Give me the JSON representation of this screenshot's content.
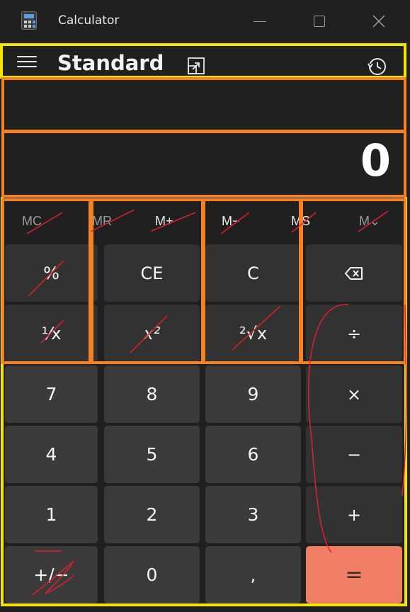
{
  "window": {
    "title": "Calculator"
  },
  "header": {
    "mode": "Standard"
  },
  "display": {
    "expression": "",
    "value": "0"
  },
  "memory": {
    "mc": "MC",
    "mr": "MR",
    "m_plus": "M+",
    "m_minus": "M−",
    "ms": "MS",
    "m_list": "M⌄"
  },
  "keypad": {
    "percent": "%",
    "ce": "CE",
    "c": "C",
    "backspace_icon": "backspace-icon",
    "reciprocal": "⅟x",
    "square": "x²",
    "sqrt": "²√x",
    "divide": "÷",
    "seven": "7",
    "eight": "8",
    "nine": "9",
    "multiply": "×",
    "four": "4",
    "five": "5",
    "six": "6",
    "minus": "−",
    "one": "1",
    "two": "2",
    "three": "3",
    "plus": "+",
    "negate": "+/−",
    "zero": "0",
    "decimal": ",",
    "equals": "="
  },
  "colors": {
    "background": "#202020",
    "key": "#3b3b3b",
    "equals_accent": "#f07e65",
    "annotation_yellow": "#f5e400",
    "annotation_orange": "#f58220",
    "annotation_red": "#e0202a"
  }
}
